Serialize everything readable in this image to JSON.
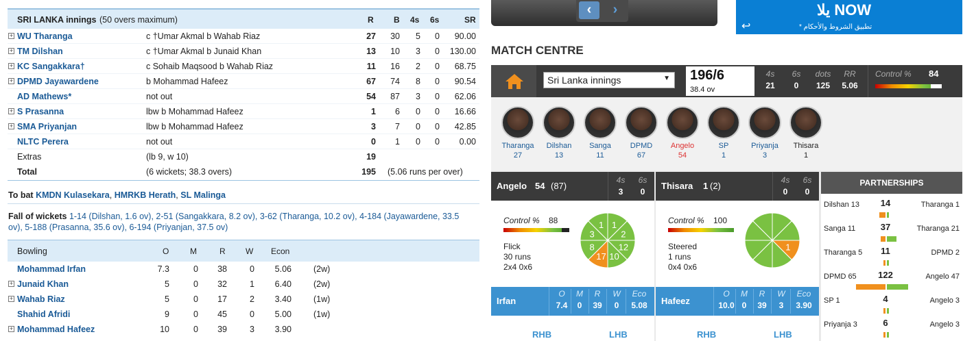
{
  "innings": {
    "title": "SRI LANKA innings",
    "subtitle": "(50 overs maximum)",
    "cols": [
      "R",
      "B",
      "4s",
      "6s",
      "SR"
    ],
    "batsmen": [
      {
        "name": "WU Tharanga",
        "dismissal": "c †Umar Akmal b Wahab Riaz",
        "r": "27",
        "b": "30",
        "fours": "5",
        "sixes": "0",
        "sr": "90.00",
        "expand": true
      },
      {
        "name": "TM Dilshan",
        "dismissal": "c †Umar Akmal b Junaid Khan",
        "r": "13",
        "b": "10",
        "fours": "3",
        "sixes": "0",
        "sr": "130.00",
        "expand": true
      },
      {
        "name": "KC Sangakkara†",
        "dismissal": "c Sohaib Maqsood b Wahab Riaz",
        "r": "11",
        "b": "16",
        "fours": "2",
        "sixes": "0",
        "sr": "68.75",
        "expand": true
      },
      {
        "name": "DPMD Jayawardene",
        "dismissal": "b Mohammad Hafeez",
        "r": "67",
        "b": "74",
        "fours": "8",
        "sixes": "0",
        "sr": "90.54",
        "expand": true
      },
      {
        "name": "AD Mathews*",
        "dismissal": "not out",
        "r": "54",
        "b": "87",
        "fours": "3",
        "sixes": "0",
        "sr": "62.06",
        "expand": false
      },
      {
        "name": "S Prasanna",
        "dismissal": "lbw b Mohammad Hafeez",
        "r": "1",
        "b": "6",
        "fours": "0",
        "sixes": "0",
        "sr": "16.66",
        "expand": true
      },
      {
        "name": "SMA Priyanjan",
        "dismissal": "lbw b Mohammad Hafeez",
        "r": "3",
        "b": "7",
        "fours": "0",
        "sixes": "0",
        "sr": "42.85",
        "expand": true
      },
      {
        "name": "NLTC Perera",
        "dismissal": "not out",
        "r": "0",
        "b": "1",
        "fours": "0",
        "sixes": "0",
        "sr": "0.00",
        "expand": false
      }
    ],
    "extras": {
      "label": "Extras",
      "detail": "(lb 9, w 10)",
      "value": "19"
    },
    "total": {
      "label": "Total",
      "detail": "(6 wickets; 38.3 overs)",
      "value": "195",
      "rate": "(5.06 runs per over)"
    },
    "to_bat_label": "To bat",
    "to_bat": [
      "KMDN Kulasekara",
      "HMRKB Herath",
      "SL Malinga"
    ],
    "fow_label": "Fall of wickets",
    "fow_line1": "1-14 (Dilshan, 1.6 ov), 2-51 (Sangakkara, 8.2 ov), 3-62 (Tharanga, 10.2 ov), 4-184 (Jayawardene, 33.5",
    "fow_line2": "ov), 5-188 (Prasanna, 35.6 ov), 6-194 (Priyanjan, 37.5 ov)"
  },
  "bowling": {
    "title": "Bowling",
    "cols": [
      "O",
      "M",
      "R",
      "W",
      "Econ"
    ],
    "bowlers": [
      {
        "name": "Mohammad Irfan",
        "o": "7.3",
        "m": "0",
        "r": "38",
        "w": "0",
        "econ": "5.06",
        "extra": "(2w)",
        "expand": false
      },
      {
        "name": "Junaid Khan",
        "o": "5",
        "m": "0",
        "r": "32",
        "w": "1",
        "econ": "6.40",
        "extra": "(2w)",
        "expand": true
      },
      {
        "name": "Wahab Riaz",
        "o": "5",
        "m": "0",
        "r": "17",
        "w": "2",
        "econ": "3.40",
        "extra": "(1w)",
        "expand": true
      },
      {
        "name": "Shahid Afridi",
        "o": "9",
        "m": "0",
        "r": "45",
        "w": "0",
        "econ": "5.00",
        "extra": "(1w)",
        "expand": false
      },
      {
        "name": "Mohammad Hafeez",
        "o": "10",
        "m": "0",
        "r": "39",
        "w": "3",
        "econ": "3.90",
        "extra": "",
        "expand": true
      }
    ]
  },
  "ad": {
    "title": "يلا NOW",
    "sub": "* تطبيق الشروط والأحكام"
  },
  "match_centre": {
    "title": "MATCH CENTRE",
    "innings_select": "Sri Lanka innings",
    "score": "196/6",
    "overs": "38.4 ov",
    "stats": [
      {
        "label": "4s",
        "value": "21"
      },
      {
        "label": "6s",
        "value": "0"
      },
      {
        "label": "dots",
        "value": "125"
      },
      {
        "label": "RR",
        "value": "5.06"
      }
    ],
    "control_label": "Control %",
    "control_value": "84",
    "players": [
      {
        "name": "Tharanga",
        "runs": "27"
      },
      {
        "name": "Dilshan",
        "runs": "13"
      },
      {
        "name": "Sanga",
        "runs": "11"
      },
      {
        "name": "DPMD",
        "runs": "67"
      },
      {
        "name": "Angelo",
        "runs": "54"
      },
      {
        "name": "SP",
        "runs": "1"
      },
      {
        "name": "Priyanja",
        "runs": "3"
      },
      {
        "name": "Thisara",
        "runs": "1"
      }
    ],
    "bat1": {
      "name": "Angelo",
      "runs": "54",
      "balls": "(87)",
      "fours": "3",
      "sixes": "0",
      "control_label": "Control %",
      "control": "88",
      "shot": "Flick",
      "shot_runs": "30 runs",
      "shot_bd": "2x4 0x6",
      "wagon": [
        "1",
        "2",
        "12",
        "10",
        "17",
        "8",
        "3",
        "1"
      ]
    },
    "bat2": {
      "name": "Thisara",
      "runs": "1",
      "balls": "(2)",
      "fours": "0",
      "sixes": "0",
      "control_label": "Control %",
      "control": "100",
      "shot": "Steered",
      "shot_runs": "1 runs",
      "shot_bd": "0x4 0x6",
      "wagon": [
        "",
        "",
        "1",
        "",
        "",
        "",
        "",
        ""
      ]
    },
    "bowl1": {
      "name": "Irfan",
      "o": "7.4",
      "m": "0",
      "r": "39",
      "w": "0",
      "eco": "5.08"
    },
    "bowl2": {
      "name": "Hafeez",
      "o": "10.0",
      "m": "0",
      "r": "39",
      "w": "3",
      "eco": "3.90"
    },
    "bowl_cols": [
      "O",
      "M",
      "R",
      "W",
      "Eco"
    ],
    "hand_labels": [
      "RHB",
      "LHB"
    ],
    "partnerships": {
      "title": "PARTNERSHIPS",
      "rows": [
        {
          "left": "Dilshan 13",
          "total": "14",
          "right": "Tharanga 1",
          "l": 13,
          "r": 1
        },
        {
          "left": "Sanga 11",
          "total": "37",
          "right": "Tharanga 21",
          "l": 11,
          "r": 21
        },
        {
          "left": "Tharanga 5",
          "total": "11",
          "right": "DPMD 2",
          "l": 5,
          "r": 2
        },
        {
          "left": "DPMD 65",
          "total": "122",
          "right": "Angelo 47",
          "l": 65,
          "r": 47
        },
        {
          "left": "SP 1",
          "total": "4",
          "right": "Angelo 3",
          "l": 1,
          "r": 3
        },
        {
          "left": "Priyanja 3",
          "total": "6",
          "right": "Angelo 3",
          "l": 3,
          "r": 3
        }
      ]
    }
  },
  "colors": {
    "link": "#1a5a96",
    "header_bg": "#dcecf8",
    "dark": "#3a3a3a",
    "accent_blue": "#3c92d0",
    "orange": "#f0901e",
    "green": "#7ac142",
    "ad_blue": "#0a7fd4"
  }
}
